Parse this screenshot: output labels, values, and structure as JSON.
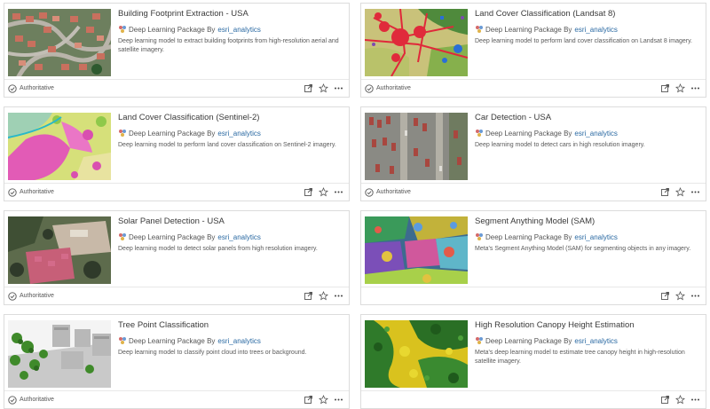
{
  "cards": [
    {
      "title": "Building Footprint Extraction - USA",
      "type_label": "Deep Learning Package By",
      "owner": "esri_analytics",
      "description": "Deep learning model to extract building footprints from high-resolution aerial and satellite imagery.",
      "badge": "Authoritative",
      "thumbnail": "building-footprint-thumbnail"
    },
    {
      "title": "Land Cover Classification (Landsat 8)",
      "type_label": "Deep Learning Package By",
      "owner": "esri_analytics",
      "description": "Deep learning model to perform land cover classification on Landsat 8 imagery.",
      "badge": "Authoritative",
      "thumbnail": "landsat-landcover-thumbnail"
    },
    {
      "title": "Land Cover Classification (Sentinel-2)",
      "type_label": "Deep Learning Package By",
      "owner": "esri_analytics",
      "description": "Deep learning model to perform land cover classification on Sentinel-2 imagery.",
      "badge": "Authoritative",
      "thumbnail": "sentinel-landcover-thumbnail"
    },
    {
      "title": "Car Detection - USA",
      "type_label": "Deep Learning Package By",
      "owner": "esri_analytics",
      "description": "Deep learning model to detect cars in high resolution imagery.",
      "badge": "Authoritative",
      "thumbnail": "car-detection-thumbnail"
    },
    {
      "title": "Solar Panel Detection - USA",
      "type_label": "Deep Learning Package By",
      "owner": "esri_analytics",
      "description": "Deep learning model to detect solar panels from high resolution imagery.",
      "badge": "Authoritative",
      "thumbnail": "solar-panel-thumbnail"
    },
    {
      "title": "Segment Anything Model (SAM)",
      "type_label": "Deep Learning Package By",
      "owner": "esri_analytics",
      "description": "Meta's Segment Anything Model (SAM) for segmenting objects in any imagery.",
      "badge": "",
      "thumbnail": "sam-thumbnail"
    },
    {
      "title": "Tree Point Classification",
      "type_label": "Deep Learning Package By",
      "owner": "esri_analytics",
      "description": "Deep learning model to classify point cloud into trees or background.",
      "badge": "Authoritative",
      "thumbnail": "tree-point-thumbnail"
    },
    {
      "title": "High Resolution Canopy Height Estimation",
      "type_label": "Deep Learning Package By",
      "owner": "esri_analytics",
      "description": "Meta's deep learning model to estimate tree canopy height in high-resolution satellite imagery.",
      "badge": "",
      "thumbnail": "canopy-height-thumbnail"
    }
  ],
  "icons": {
    "package": "deep-learning-package-icon",
    "authoritative": "check-circle-icon",
    "open": "open-in-new-icon",
    "favorite": "star-icon",
    "more": "more-options-icon"
  },
  "colors": {
    "owner_link": "#2b6aa3",
    "border": "#dcdcdc"
  }
}
